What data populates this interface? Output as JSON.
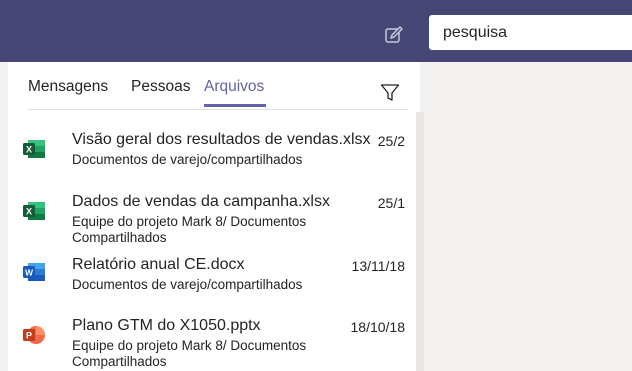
{
  "header": {
    "compose_icon": "compose-icon",
    "search": {
      "value": "pesquisa",
      "placeholder": ""
    }
  },
  "tabs": [
    {
      "label": "Mensagens",
      "active": false
    },
    {
      "label": "Pessoas",
      "active": false
    },
    {
      "label": "Arquivos",
      "active": true
    }
  ],
  "filter_icon": "filter-icon",
  "files": [
    {
      "type": "excel",
      "name": "Visão geral dos resultados de vendas.xlsx",
      "date": "25/2",
      "location": "Documentos de varejo/compartilhados"
    },
    {
      "type": "excel",
      "name": "Dados de vendas da campanha.xlsx",
      "date": "25/1",
      "location": "Equipe do projeto Mark 8/ Documentos Compartilhados"
    },
    {
      "type": "word",
      "name": "Relatório anual CE.docx",
      "date": "13/11/18",
      "location": "Documentos de varejo/compartilhados"
    },
    {
      "type": "powerpoint",
      "name": "Plano GTM do X1050.pptx",
      "date": "18/10/18",
      "location": "Equipe do projeto Mark 8/ Documentos Compartilhados"
    }
  ],
  "colors": {
    "header": "#464775",
    "accent": "#6264a7",
    "excel": "#217346",
    "word": "#2b579a",
    "powerpoint": "#d24726"
  }
}
